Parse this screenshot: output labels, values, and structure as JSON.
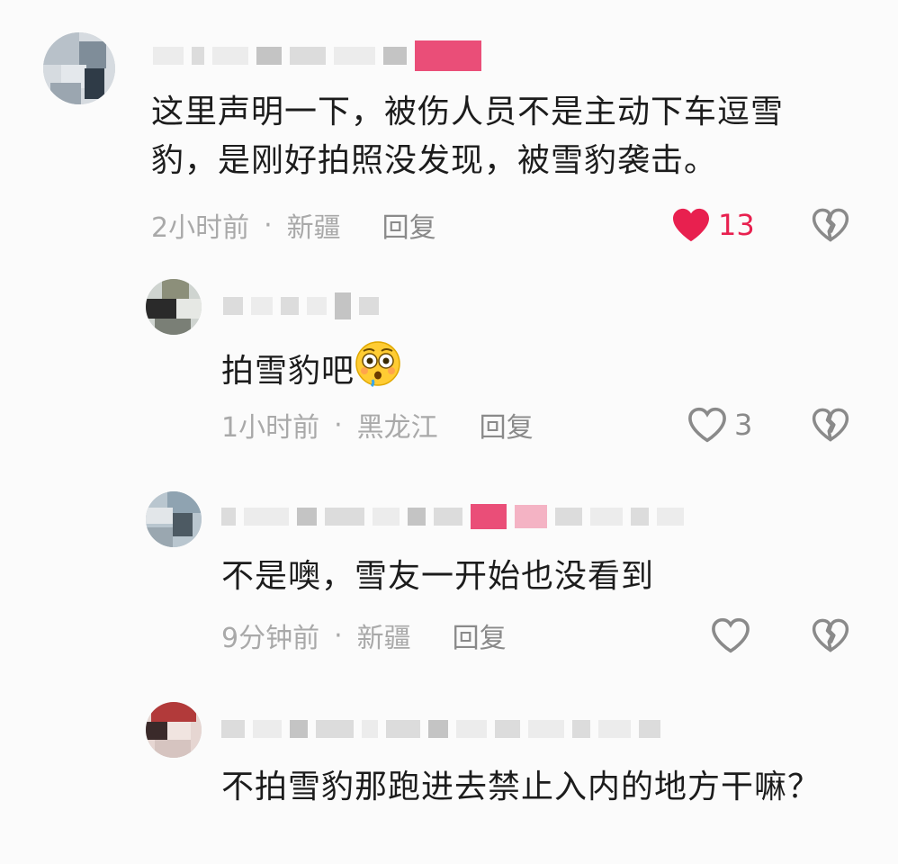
{
  "comments": [
    {
      "text": "这里声明一下，被伤人员不是主动下车逗雪豹，是刚好拍照没发现，被雪豹袭击。",
      "time": "2小时前",
      "location": "新疆",
      "reply": "回复",
      "likes": "13",
      "liked": true
    },
    {
      "text": "拍雪豹吧",
      "emoji": "flushed-face",
      "time": "1小时前",
      "location": "黑龙江",
      "reply": "回复",
      "likes": "3",
      "liked": false
    },
    {
      "text": "不是噢，雪友一开始也没看到",
      "time": "9分钟前",
      "location": "新疆",
      "reply": "回复",
      "likes": "",
      "liked": false
    },
    {
      "text": "不拍雪豹那跑进去禁止入内的地方干嘛？"
    }
  ],
  "colors": {
    "like_active": "#e8204f",
    "meta": "#a9a9a9",
    "icon": "#8a8a8a"
  },
  "separator": "·"
}
